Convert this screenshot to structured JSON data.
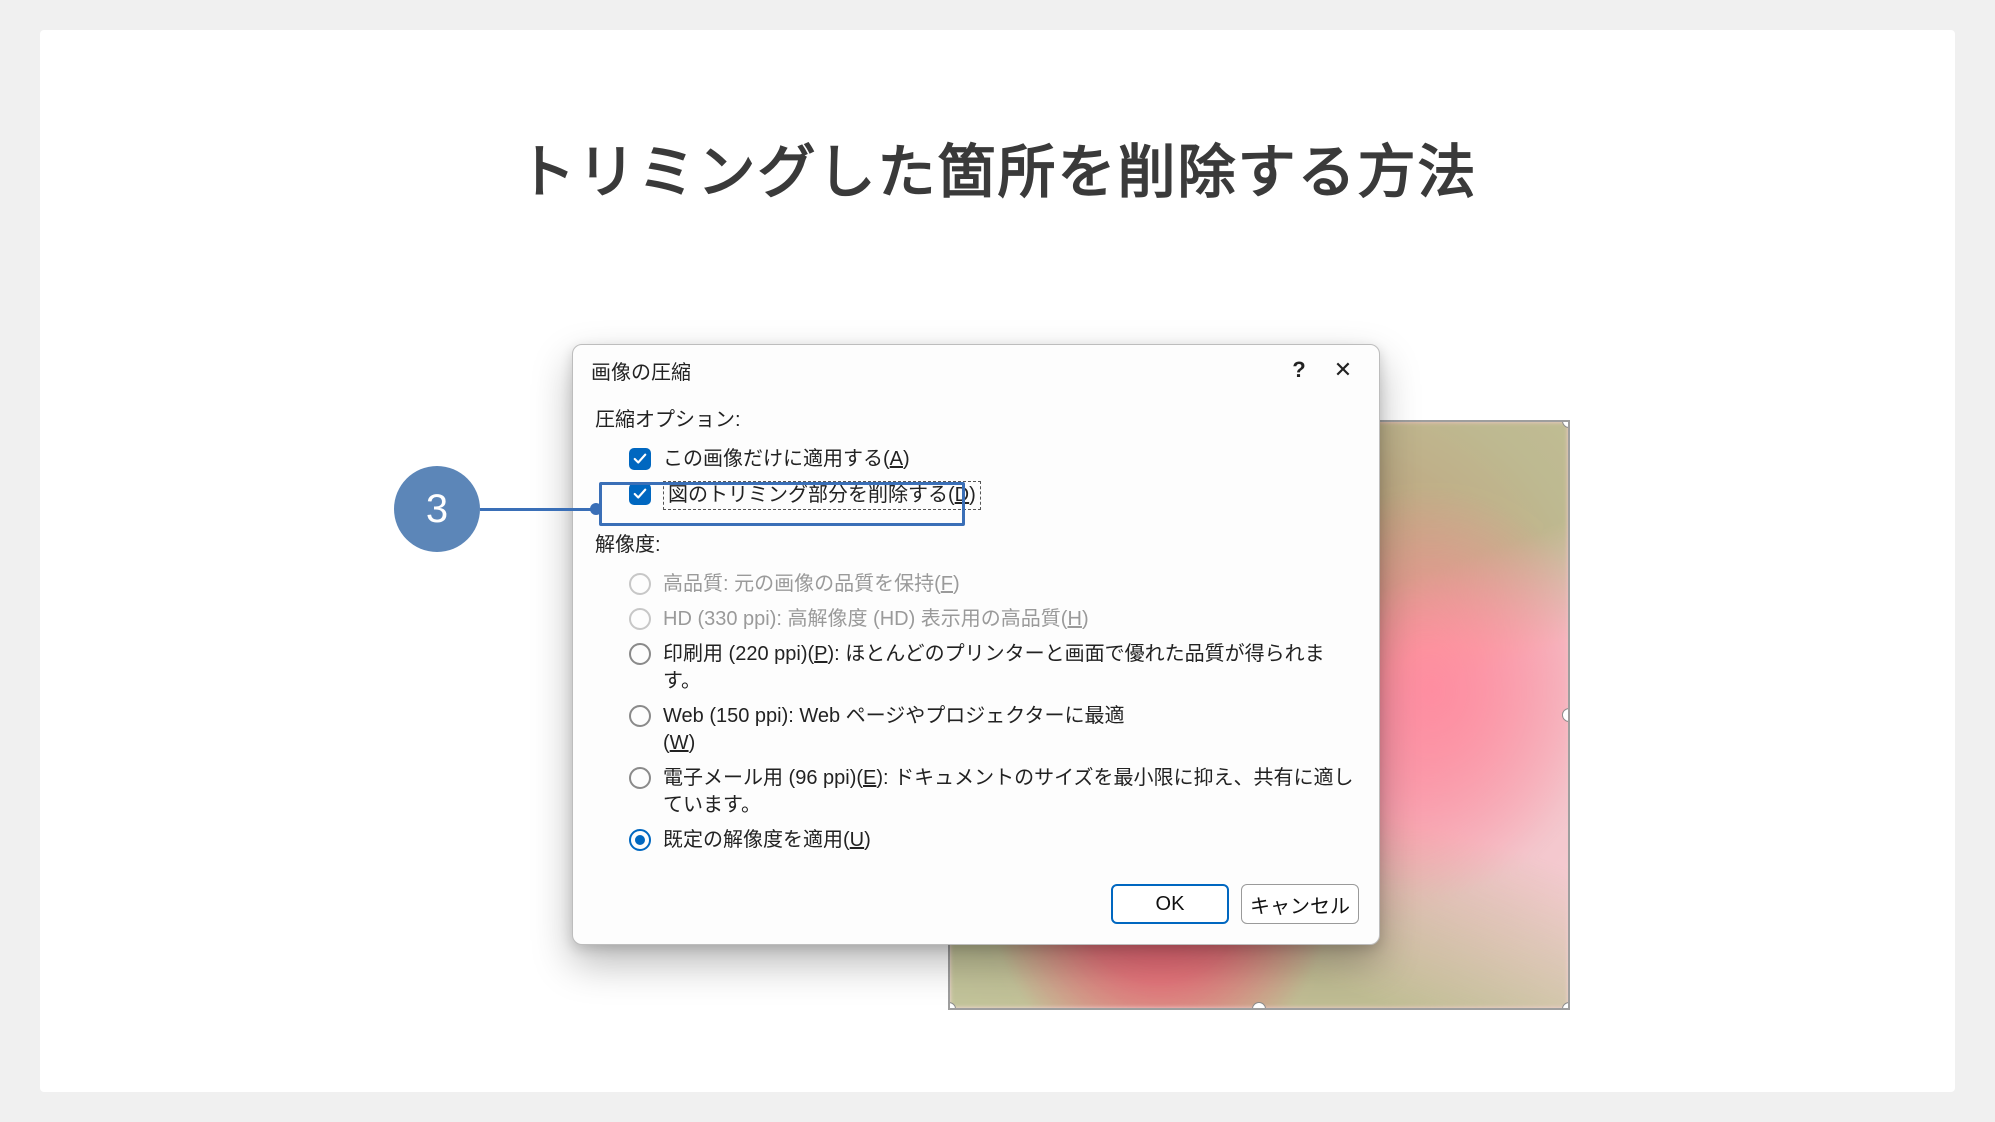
{
  "page": {
    "title": "トリミングした箇所を削除する方法"
  },
  "step": {
    "number": "3"
  },
  "dialog": {
    "title": "画像の圧縮",
    "compression_label": "圧縮オプション:",
    "resolution_label": "解像度:",
    "checkboxes": {
      "apply_only": {
        "label": "この画像だけに適用する(",
        "key": "A",
        "tail": ")",
        "checked": true
      },
      "delete_crop": {
        "label": "図のトリミング部分を削除する(",
        "key": "D",
        "tail": ")",
        "checked": true
      }
    },
    "radios": {
      "high": {
        "label": "高品質: 元の画像の品質を保持(",
        "key": "F",
        "tail": ")",
        "disabled": true
      },
      "hd": {
        "label": "HD (330 ppi): 高解像度 (HD) 表示用の高品質(",
        "key": "H",
        "tail": ")",
        "disabled": true
      },
      "print": {
        "label": "印刷用 (220 ppi)(",
        "key": "P",
        "tail": "): ほとんどのプリンターと画面で優れた品質が得られます。"
      },
      "web": {
        "label": "Web (150 ppi): Web ページやプロジェクターに最適(",
        "key": "W",
        "tail": ")"
      },
      "email": {
        "label": "電子メール用 (96 ppi)(",
        "key": "E",
        "tail": "): ドキュメントのサイズを最小限に抑え、共有に適しています。"
      },
      "default": {
        "label": "既定の解像度を適用(",
        "key": "U",
        "tail": ")",
        "selected": true
      }
    },
    "ok_label": "OK",
    "cancel_label": "キャンセル"
  }
}
